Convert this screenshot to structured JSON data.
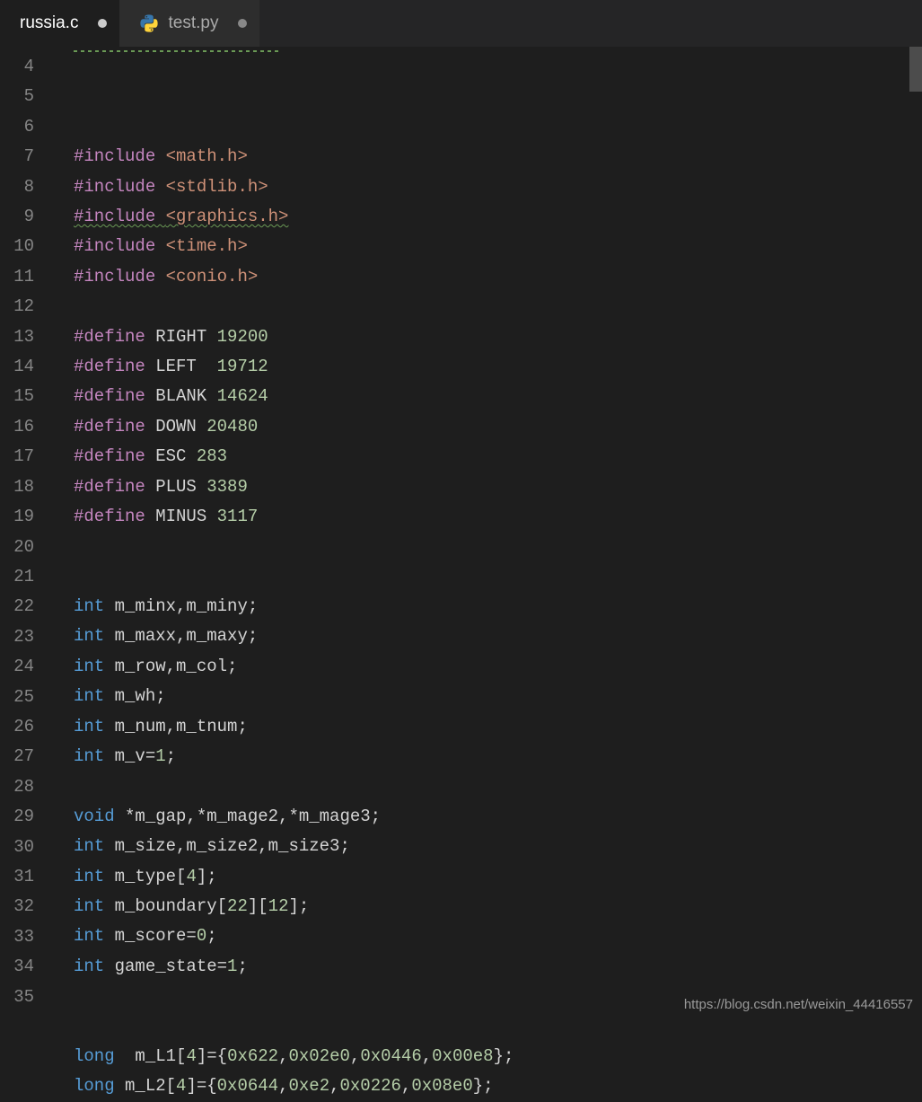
{
  "tabs": [
    {
      "label": "russia.c",
      "active": true,
      "modified": true,
      "icon": "c-file-icon"
    },
    {
      "label": "test.py",
      "active": false,
      "modified": true,
      "icon": "python-file-icon"
    }
  ],
  "code": {
    "first_line_no": 4,
    "lines": [
      {
        "tokens": [
          {
            "t": "#include ",
            "c": "tk-include"
          },
          {
            "t": "<math.h>",
            "c": "tk-header"
          }
        ]
      },
      {
        "tokens": [
          {
            "t": "#include ",
            "c": "tk-include"
          },
          {
            "t": "<stdlib.h>",
            "c": "tk-header"
          }
        ]
      },
      {
        "tokens": [
          {
            "t": "#include ",
            "c": "tk-include squiggle-green"
          },
          {
            "t": "<graphics.h>",
            "c": "tk-header squiggle-green"
          }
        ]
      },
      {
        "tokens": [
          {
            "t": "#include ",
            "c": "tk-include"
          },
          {
            "t": "<time.h>",
            "c": "tk-header"
          }
        ]
      },
      {
        "tokens": [
          {
            "t": "#include ",
            "c": "tk-include"
          },
          {
            "t": "<conio.h>",
            "c": "tk-header"
          }
        ]
      },
      {
        "tokens": []
      },
      {
        "tokens": [
          {
            "t": "#define ",
            "c": "tk-preproc"
          },
          {
            "t": "RIGHT ",
            "c": "tk-define-name"
          },
          {
            "t": "19200",
            "c": "tk-num"
          }
        ]
      },
      {
        "tokens": [
          {
            "t": "#define ",
            "c": "tk-preproc"
          },
          {
            "t": "LEFT  ",
            "c": "tk-define-name"
          },
          {
            "t": "19712",
            "c": "tk-num"
          }
        ]
      },
      {
        "tokens": [
          {
            "t": "#define ",
            "c": "tk-preproc"
          },
          {
            "t": "BLANK ",
            "c": "tk-define-name"
          },
          {
            "t": "14624",
            "c": "tk-num"
          }
        ]
      },
      {
        "tokens": [
          {
            "t": "#define ",
            "c": "tk-preproc"
          },
          {
            "t": "DOWN ",
            "c": "tk-define-name"
          },
          {
            "t": "20480",
            "c": "tk-num"
          }
        ]
      },
      {
        "tokens": [
          {
            "t": "#define ",
            "c": "tk-preproc"
          },
          {
            "t": "ESC ",
            "c": "tk-define-name"
          },
          {
            "t": "283",
            "c": "tk-num"
          }
        ]
      },
      {
        "tokens": [
          {
            "t": "#define ",
            "c": "tk-preproc"
          },
          {
            "t": "PLUS ",
            "c": "tk-define-name"
          },
          {
            "t": "3389",
            "c": "tk-num"
          }
        ]
      },
      {
        "tokens": [
          {
            "t": "#define ",
            "c": "tk-preproc"
          },
          {
            "t": "MINUS ",
            "c": "tk-define-name"
          },
          {
            "t": "3117",
            "c": "tk-num"
          }
        ]
      },
      {
        "tokens": []
      },
      {
        "tokens": []
      },
      {
        "tokens": [
          {
            "t": "int",
            "c": "tk-type"
          },
          {
            "t": " m_minx,m_miny;",
            "c": "tk-ident"
          }
        ]
      },
      {
        "tokens": [
          {
            "t": "int",
            "c": "tk-type"
          },
          {
            "t": " m_maxx,m_maxy;",
            "c": "tk-ident"
          }
        ]
      },
      {
        "tokens": [
          {
            "t": "int",
            "c": "tk-type"
          },
          {
            "t": " m_row,m_col;",
            "c": "tk-ident"
          }
        ]
      },
      {
        "tokens": [
          {
            "t": "int",
            "c": "tk-type"
          },
          {
            "t": " m_wh;",
            "c": "tk-ident"
          }
        ]
      },
      {
        "tokens": [
          {
            "t": "int",
            "c": "tk-type"
          },
          {
            "t": " m_num,m_tnum;",
            "c": "tk-ident"
          }
        ]
      },
      {
        "tokens": [
          {
            "t": "int",
            "c": "tk-type"
          },
          {
            "t": " m_v=",
            "c": "tk-ident"
          },
          {
            "t": "1",
            "c": "tk-num"
          },
          {
            "t": ";",
            "c": "tk-punct"
          }
        ]
      },
      {
        "tokens": []
      },
      {
        "tokens": [
          {
            "t": "void",
            "c": "tk-type"
          },
          {
            "t": " *m_gap,*m_mage2,*m_mage3;",
            "c": "tk-ident"
          }
        ]
      },
      {
        "tokens": [
          {
            "t": "int",
            "c": "tk-type"
          },
          {
            "t": " m_size,m_size2,m_size3;",
            "c": "tk-ident"
          }
        ]
      },
      {
        "tokens": [
          {
            "t": "int",
            "c": "tk-type"
          },
          {
            "t": " m_type[",
            "c": "tk-ident"
          },
          {
            "t": "4",
            "c": "tk-num"
          },
          {
            "t": "];",
            "c": "tk-punct"
          }
        ]
      },
      {
        "tokens": [
          {
            "t": "int",
            "c": "tk-type"
          },
          {
            "t": " m_boundary[",
            "c": "tk-ident"
          },
          {
            "t": "22",
            "c": "tk-num"
          },
          {
            "t": "][",
            "c": "tk-punct"
          },
          {
            "t": "12",
            "c": "tk-num"
          },
          {
            "t": "];",
            "c": "tk-punct"
          }
        ]
      },
      {
        "tokens": [
          {
            "t": "int",
            "c": "tk-type"
          },
          {
            "t": " m_score=",
            "c": "tk-ident"
          },
          {
            "t": "0",
            "c": "tk-num"
          },
          {
            "t": ";",
            "c": "tk-punct"
          }
        ]
      },
      {
        "tokens": [
          {
            "t": "int",
            "c": "tk-type"
          },
          {
            "t": " game_state=",
            "c": "tk-ident"
          },
          {
            "t": "1",
            "c": "tk-num"
          },
          {
            "t": ";",
            "c": "tk-punct"
          }
        ]
      },
      {
        "tokens": []
      },
      {
        "tokens": []
      },
      {
        "tokens": [
          {
            "t": "long",
            "c": "tk-type"
          },
          {
            "t": "  m_L1[",
            "c": "tk-ident"
          },
          {
            "t": "4",
            "c": "tk-num"
          },
          {
            "t": "]={",
            "c": "tk-punct"
          },
          {
            "t": "0x622",
            "c": "tk-num"
          },
          {
            "t": ",",
            "c": "tk-punct"
          },
          {
            "t": "0x02e0",
            "c": "tk-num"
          },
          {
            "t": ",",
            "c": "tk-punct"
          },
          {
            "t": "0x0446",
            "c": "tk-num"
          },
          {
            "t": ",",
            "c": "tk-punct"
          },
          {
            "t": "0x00e8",
            "c": "tk-num"
          },
          {
            "t": "};",
            "c": "tk-punct"
          }
        ]
      },
      {
        "tokens": [
          {
            "t": "long",
            "c": "tk-type"
          },
          {
            "t": " m_L2[",
            "c": "tk-ident"
          },
          {
            "t": "4",
            "c": "tk-num"
          },
          {
            "t": "]={",
            "c": "tk-punct"
          },
          {
            "t": "0x0644",
            "c": "tk-num"
          },
          {
            "t": ",",
            "c": "tk-punct"
          },
          {
            "t": "0xe2",
            "c": "tk-num"
          },
          {
            "t": ",",
            "c": "tk-punct"
          },
          {
            "t": "0x0226",
            "c": "tk-num"
          },
          {
            "t": ",",
            "c": "tk-punct"
          },
          {
            "t": "0x08e0",
            "c": "tk-num"
          },
          {
            "t": "};",
            "c": "tk-punct"
          }
        ]
      }
    ]
  },
  "watermark": "https://blog.csdn.net/weixin_44416557"
}
